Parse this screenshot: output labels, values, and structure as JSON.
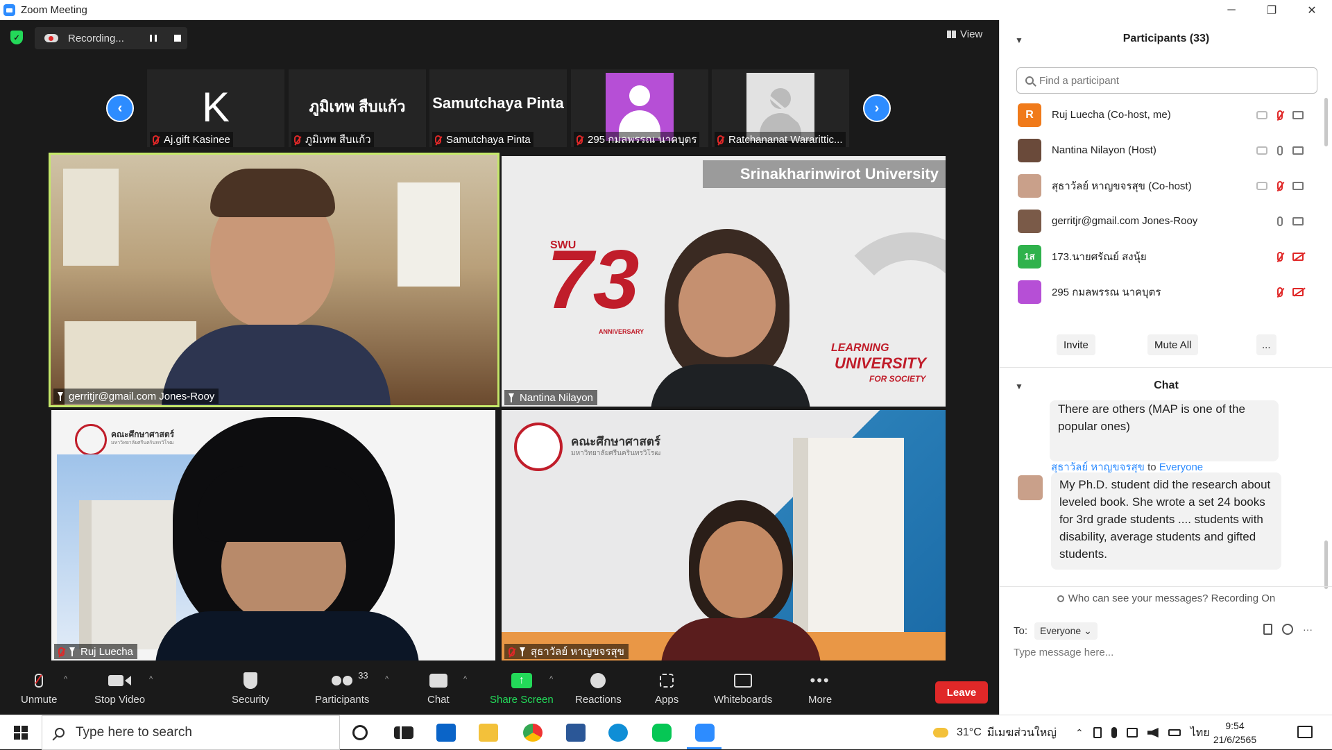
{
  "window": {
    "title": "Zoom Meeting",
    "controls": [
      "─",
      "❐",
      "✕"
    ]
  },
  "meeting": {
    "recording_label": "Recording...",
    "view_label": "View",
    "strip": [
      {
        "name": "Aj.gift Kasinee",
        "avatar_letter": "K",
        "avatar_color": "#8b6a5c"
      },
      {
        "name": "ภูมิเทพ สืบแก้ว",
        "display_text": "ภูมิเทพ สืบแก้ว"
      },
      {
        "name": "Samutchaya Pinta",
        "display_text": "Samutchaya Pinta"
      },
      {
        "name": "295 กมลพรรณ นาคบุตร",
        "avatar_color": "#b64fd6"
      },
      {
        "name": "Ratchananat Wararittic..."
      }
    ],
    "videos": [
      {
        "name": "gerritjr@gmail.com Jones-Rooy",
        "active_speaker": true
      },
      {
        "name": "Nantina Nilayon",
        "banner_text": "Srinakharinwirot University",
        "logo_brand": "SWU",
        "logo_number": "73",
        "logo_sub": "ANNIVERSARY",
        "tag_line1": "LEARNING",
        "tag_line2": "UNIVERSITY",
        "tag_line3": "FOR SOCIETY"
      },
      {
        "name": "Ruj Luecha",
        "org_text": "คณะศึกษาศาสตร์",
        "org_sub": "มหาวิทยาลัยศรีนครินทรวิโรฒ"
      },
      {
        "name": "สุธาวัลย์ หาญขจรสุข",
        "org_text": "คณะศึกษาศาสตร์",
        "org_sub": "มหาวิทยาลัยศรีนครินทรวิโรฒ"
      }
    ]
  },
  "toolbar": {
    "unmute": "Unmute",
    "stop_video": "Stop Video",
    "security": "Security",
    "participants": "Participants",
    "participants_count": "33",
    "chat": "Chat",
    "share_screen": "Share Screen",
    "reactions": "Reactions",
    "apps": "Apps",
    "whiteboards": "Whiteboards",
    "more": "More",
    "leave": "Leave"
  },
  "panel": {
    "participants_title": "Participants (33)",
    "search_placeholder": "Find a participant",
    "participants": [
      {
        "name": "Ruj Luecha (Co-host, me)",
        "avatar": "R",
        "color": "#f07a1a"
      },
      {
        "name": "Nantina Nilayon (Host)",
        "avatar": "",
        "color": "#6a4a3a"
      },
      {
        "name": "สุธาวัลย์ หาญขจรสุข (Co-host)",
        "avatar": "",
        "color": "#c9a08a"
      },
      {
        "name": "gerritjr@gmail.com Jones-Rooy",
        "avatar": "",
        "color": "#7a5a48"
      },
      {
        "name": "173.นายศรัณย์ สงนุ้ย",
        "avatar": "1ส",
        "color": "#2fb24c"
      },
      {
        "name": "295 กมลพรรณ นาคบุตร",
        "avatar": "",
        "color": "#b64fd6"
      }
    ],
    "invite": "Invite",
    "mute_all": "Mute All",
    "more_btn": "...",
    "chat_title": "Chat",
    "chat_prev": "There are others (MAP is one of the popular ones)",
    "chat_sender": "สุธาวัลย์ หาญขจรสุข",
    "chat_to_word": "to",
    "chat_to": "Everyone",
    "chat_message": "My Ph.D. student did the research about leveled book.  She wrote a set 24 books for 3rd grade students .... students with disability, average students and gifted students.",
    "who_can_see": "Who can see your messages? Recording On",
    "to_label": "To:",
    "to_value": "Everyone",
    "type_placeholder": "Type message here..."
  },
  "taskbar": {
    "search_placeholder": "Type here to search",
    "weather": "31°C",
    "weather_desc": "มีเมฆส่วนใหญ่",
    "language": "ไทย",
    "time": "9:54",
    "date": "21/6/2565"
  }
}
